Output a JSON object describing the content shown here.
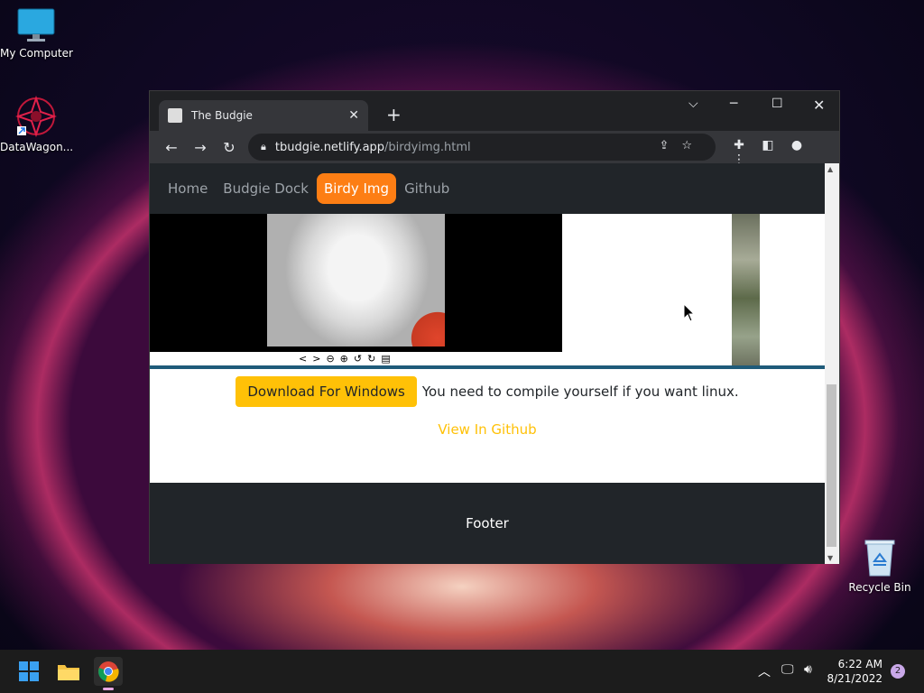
{
  "desktop": {
    "icons": [
      {
        "label": "My Computer"
      },
      {
        "label": "DataWagon..."
      },
      {
        "label": "Recycle Bin"
      }
    ]
  },
  "browser": {
    "tab_title": "The Budgie",
    "url_host": "tbudgie.netlify.app",
    "url_path": "/birdyimg.html"
  },
  "page": {
    "nav": [
      {
        "label": "Home"
      },
      {
        "label": "Budgie Dock"
      },
      {
        "label": "Birdy Img",
        "active": true
      },
      {
        "label": "Github"
      }
    ],
    "download_button": "Download For Windows",
    "linux_note": "You need to compile yourself if you want linux.",
    "github_link": "View In Github",
    "footer": "Footer"
  },
  "taskbar": {
    "time": "6:22 AM",
    "date": "8/21/2022",
    "notification_count": "2"
  },
  "colors": {
    "accent_orange": "#fd7e14",
    "accent_yellow": "#ffc107",
    "dark": "#212529"
  }
}
